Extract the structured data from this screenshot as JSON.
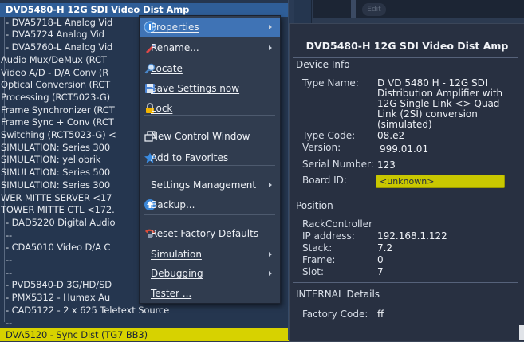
{
  "tree": {
    "rows": [
      {
        "text": "DVD5480-H 12G SDI Video Dist Amp",
        "style": "selected",
        "indent": 6
      },
      {
        "text": "- DVA5718-L Analog Vid",
        "style": "",
        "indent": 6
      },
      {
        "text": "- DVA5724 Analog Vid",
        "style": "",
        "indent": 6
      },
      {
        "text": "- DVA5760-L Analog Vid",
        "style": "",
        "indent": 6
      },
      {
        "text": "Audio Mux/DeMux (RCT",
        "style": "",
        "indent": 0
      },
      {
        "text": "Video A/D - D/A Conv (R",
        "style": "",
        "indent": 0
      },
      {
        "text": "Optical Conversion (RCT",
        "style": "",
        "indent": 0
      },
      {
        "text": "Processing (RCT5023-G)",
        "style": "",
        "indent": 0
      },
      {
        "text": "Frame Synchronizer (RCT",
        "style": "",
        "indent": 0
      },
      {
        "text": "Frame Sync + Conv (RCT",
        "style": "",
        "indent": 0
      },
      {
        "text": "Switching (RCT5023-G) <",
        "style": "",
        "indent": 0
      },
      {
        "text": "SIMULATION: Series 300",
        "style": "",
        "indent": 0
      },
      {
        "text": "SIMULATION: yellobrik",
        "style": "",
        "indent": 0
      },
      {
        "text": "SIMULATION: Series 500",
        "style": "",
        "indent": 0
      },
      {
        "text": "SIMULATION: Series 300",
        "style": "",
        "indent": 0
      },
      {
        "text": "WER MITTE SERVER <17",
        "style": "",
        "indent": 0
      },
      {
        "text": "TOWER MITTE CTL <172.",
        "style": "",
        "indent": 0
      },
      {
        "text": "- DAD5220 Digital Audio",
        "style": "",
        "indent": 6
      },
      {
        "text": "--",
        "style": "dim",
        "indent": 6
      },
      {
        "text": "- CDA5010 Video D/A C",
        "style": "",
        "indent": 6
      },
      {
        "text": "--",
        "style": "dim",
        "indent": 6
      },
      {
        "text": "--",
        "style": "dim",
        "indent": 6
      },
      {
        "text": "- PVD5840-D 3G/HD/SD",
        "style": "",
        "indent": 6
      },
      {
        "text": "- PMX5312 - Humax Au",
        "style": "",
        "indent": 6
      },
      {
        "text": "- CAD5122 - 2 x 625 Teletext Source",
        "style": "",
        "indent": 6
      },
      {
        "text": "--",
        "style": "dim",
        "indent": 6
      },
      {
        "text": "DVA5120 - Sync Dist (TG7 BB3)",
        "style": "highlight-yellow",
        "indent": 6
      }
    ]
  },
  "topbar": {
    "edit_label": "Edit"
  },
  "menu": {
    "items": [
      {
        "label": "Properties",
        "icon": "info-icon",
        "arrow": true,
        "underline": true,
        "active": true
      },
      {
        "label": "Rename...",
        "icon": "pencil-icon",
        "arrow": true,
        "underline": true
      },
      {
        "label": "Locate",
        "icon": "magnifier-icon",
        "arrow": false,
        "underline": true
      },
      {
        "label": "Save Settings now",
        "icon": "floppy-icon",
        "arrow": false,
        "underline": true
      },
      {
        "label": "Lock",
        "icon": "lock-icon",
        "arrow": false,
        "underline": true
      },
      {
        "label": "New Control Window",
        "icon": "window-icon",
        "arrow": false,
        "underline": false
      },
      {
        "label": "Add to Favorites",
        "icon": "star-icon",
        "arrow": false,
        "underline": true
      },
      {
        "label": "Settings Management",
        "icon": "",
        "arrow": true,
        "underline": false
      },
      {
        "label": "Backup...",
        "icon": "backup-icon",
        "arrow": false,
        "underline": true
      },
      {
        "label": "Reset Factory Defaults",
        "icon": "reset-icon",
        "arrow": false,
        "underline": false
      },
      {
        "label": "Simulation",
        "icon": "",
        "arrow": true,
        "underline": true
      },
      {
        "label": "Debugging",
        "icon": "",
        "arrow": true,
        "underline": true
      },
      {
        "label": "Tester ...",
        "icon": "",
        "arrow": false,
        "underline": true
      }
    ]
  },
  "panel": {
    "title": "DVD5480-H 12G SDI Video Dist Amp",
    "device_info_header": "Device Info",
    "type_name_label": "Type Name:",
    "type_name_value": "D VD 5480 H - 12G SDI Distribution Amplifier with 12G Single Link <> Quad Link (2SI) conversion (simulated)",
    "type_code_label": "Type Code:",
    "type_code_value": "08.e2",
    "version_label": "Version:",
    "version_value": "999.01.01",
    "serial_label": "Serial Number:",
    "serial_value": "123",
    "board_id_label": "Board ID:",
    "board_id_value": "<unknown>",
    "position_header": "Position",
    "rack_controller": "RackController",
    "ip_label": "IP address:",
    "ip_value": "192.168.1.122",
    "stack_label": "Stack:",
    "stack_value": "7.2",
    "frame_label": "Frame:",
    "frame_value": "0",
    "slot_label": "Slot:",
    "slot_value": "7",
    "internal_header": "INTERNAL Details",
    "factory_label": "Factory Code:",
    "factory_value": "ff"
  }
}
